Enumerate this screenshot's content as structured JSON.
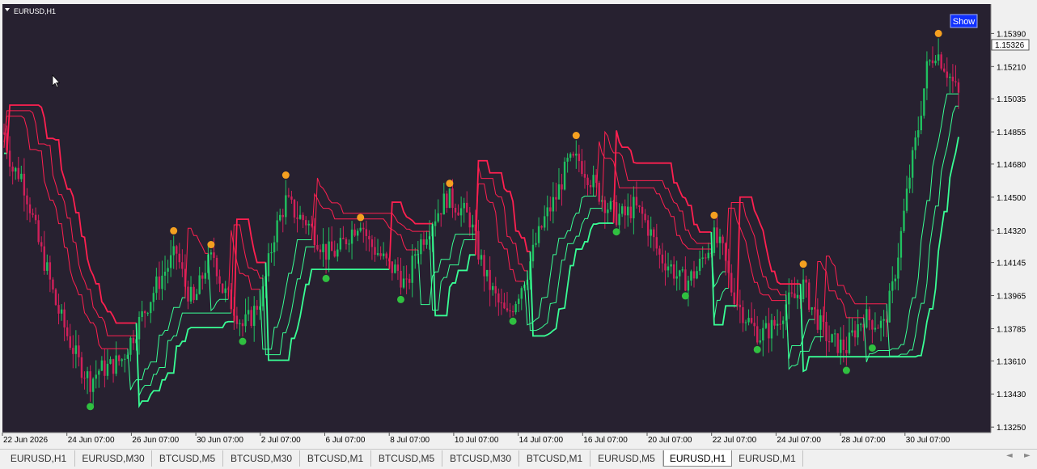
{
  "window": {
    "symbol_label": "EURUSD,H1",
    "show_button": "Show",
    "current_price": "1.15326"
  },
  "colors": {
    "background": "#272130",
    "bull": "#20c060",
    "bear": "#d0205a",
    "line_up": "#39ff95",
    "line_down": "#ff2050",
    "marker_sell": "#f5a020",
    "marker_buy": "#30c040",
    "show_button_bg": "#1030ff",
    "price_box_bg": "#ffffff"
  },
  "chart_data": {
    "type": "candlestick",
    "symbol": "EURUSD",
    "timeframe": "H1",
    "ylim": [
      1.1322,
      1.1555
    ],
    "y_ticks": [
      "1.15390",
      "1.15210",
      "1.15035",
      "1.14855",
      "1.14680",
      "1.14500",
      "1.14320",
      "1.14145",
      "1.13965",
      "1.13785",
      "1.13610",
      "1.13430",
      "1.13250"
    ],
    "x_ticks": [
      "22 Jun 2026",
      "24 Jun 07:00",
      "26 Jun 07:00",
      "30 Jun 07:00",
      "2 Jul 07:00",
      "6 Jul 07:00",
      "8 Jul 07:00",
      "10 Jul 07:00",
      "14 Jul 07:00",
      "16 Jul 07:00",
      "20 Jul 07:00",
      "22 Jul 07:00",
      "24 Jul 07:00",
      "28 Jul 07:00",
      "30 Jul 07:00"
    ],
    "last_price": 1.15326,
    "price_path": [
      [
        0,
        1.1485
      ],
      [
        3,
        1.1465
      ],
      [
        6,
        1.1462
      ],
      [
        9,
        1.1445
      ],
      [
        12,
        1.1425
      ],
      [
        15,
        1.141
      ],
      [
        18,
        1.1392
      ],
      [
        22,
        1.1375
      ],
      [
        26,
        1.136
      ],
      [
        30,
        1.135
      ],
      [
        33,
        1.1356
      ],
      [
        37,
        1.1358
      ],
      [
        41,
        1.1362
      ],
      [
        44,
        1.1372
      ],
      [
        47,
        1.1382
      ],
      [
        50,
        1.1392
      ],
      [
        53,
        1.1402
      ],
      [
        56,
        1.141
      ],
      [
        60,
        1.142
      ],
      [
        63,
        1.1402
      ],
      [
        66,
        1.1392
      ],
      [
        70,
        1.1412
      ],
      [
        73,
        1.1418
      ],
      [
        76,
        1.14
      ],
      [
        80,
        1.139
      ],
      [
        83,
        1.138
      ],
      [
        86,
        1.1385
      ],
      [
        90,
        1.1398
      ],
      [
        94,
        1.143
      ],
      [
        98,
        1.1448
      ],
      [
        102,
        1.144
      ],
      [
        105,
        1.1437
      ],
      [
        108,
        1.143
      ],
      [
        112,
        1.142
      ],
      [
        116,
        1.142
      ],
      [
        120,
        1.143
      ],
      [
        124,
        1.1438
      ],
      [
        127,
        1.1425
      ],
      [
        130,
        1.142
      ],
      [
        134,
        1.1412
      ],
      [
        137,
        1.141
      ],
      [
        140,
        1.14
      ],
      [
        143,
        1.142
      ],
      [
        147,
        1.1432
      ],
      [
        150,
        1.144
      ],
      [
        154,
        1.145
      ],
      [
        158,
        1.1445
      ],
      [
        162,
        1.1438
      ],
      [
        165,
        1.142
      ],
      [
        168,
        1.1405
      ],
      [
        172,
        1.1392
      ],
      [
        175,
        1.1385
      ],
      [
        178,
        1.1395
      ],
      [
        182,
        1.141
      ],
      [
        185,
        1.1425
      ],
      [
        188,
        1.1438
      ],
      [
        192,
        1.145
      ],
      [
        196,
        1.1468
      ],
      [
        200,
        1.147
      ],
      [
        204,
        1.146
      ],
      [
        207,
        1.1452
      ],
      [
        210,
        1.1445
      ],
      [
        213,
        1.144
      ],
      [
        216,
        1.144
      ],
      [
        219,
        1.1445
      ],
      [
        222,
        1.144
      ],
      [
        225,
        1.143
      ],
      [
        228,
        1.1418
      ],
      [
        232,
        1.1412
      ],
      [
        235,
        1.1405
      ],
      [
        238,
        1.1405
      ],
      [
        241,
        1.141
      ],
      [
        244,
        1.142
      ],
      [
        247,
        1.1428
      ],
      [
        250,
        1.142
      ],
      [
        253,
        1.14
      ],
      [
        256,
        1.139
      ],
      [
        260,
        1.138
      ],
      [
        263,
        1.1375
      ],
      [
        266,
        1.1378
      ],
      [
        269,
        1.1382
      ],
      [
        272,
        1.1392
      ],
      [
        275,
        1.1395
      ],
      [
        278,
        1.1402
      ],
      [
        281,
        1.139
      ],
      [
        284,
        1.138
      ],
      [
        287,
        1.1372
      ],
      [
        290,
        1.137
      ],
      [
        293,
        1.1368
      ],
      [
        296,
        1.1378
      ],
      [
        299,
        1.1385
      ],
      [
        303,
        1.1382
      ],
      [
        306,
        1.138
      ],
      [
        309,
        1.14
      ],
      [
        312,
        1.143
      ],
      [
        315,
        1.1462
      ],
      [
        318,
        1.1488
      ],
      [
        321,
        1.152
      ],
      [
        324,
        1.153
      ],
      [
        327,
        1.1522
      ],
      [
        330,
        1.1512
      ],
      [
        332,
        1.1505
      ]
    ]
  },
  "tabs": [
    "EURUSD,H1",
    "EURUSD,M30",
    "BTCUSD,M5",
    "BTCUSD,M30",
    "BTCUSD,M1",
    "BTCUSD,M5",
    "BTCUSD,M30",
    "BTCUSD,M1",
    "EURUSD,M5",
    "EURUSD,H1",
    "EURUSD,M1"
  ],
  "active_tab_index": 9,
  "tab_arrows": [
    "◄",
    "►"
  ]
}
